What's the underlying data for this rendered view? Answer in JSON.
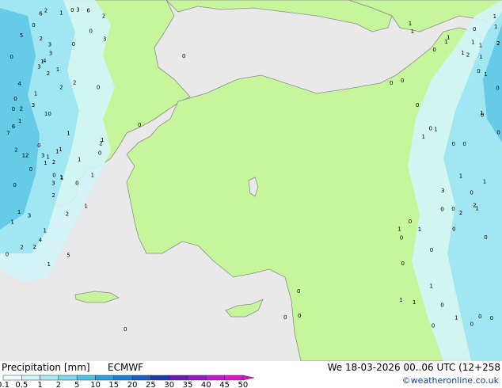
{
  "title": "Precipitation [mm]",
  "model": "ECMWF",
  "valid_time": "We 18-03-2026 00..06 UTC (12+258",
  "credit": "©weatheronline.co.uk",
  "colors": {
    "land": "#c6f59c",
    "sea": "#e9e9e9",
    "coast": "#8c8c8c",
    "rain_light": "#d2f5fa",
    "rain_mid": "#9ee6f2",
    "rain_heavy": "#5ec8e6"
  },
  "legend": {
    "ticks": [
      "0.1",
      "0.5",
      "1",
      "2",
      "5",
      "10",
      "15",
      "20",
      "25",
      "30",
      "35",
      "40",
      "45",
      "50"
    ],
    "colors": [
      "#ecfcff",
      "#cdf3fb",
      "#a8e9f6",
      "#7fd9f0",
      "#4fc2ea",
      "#2a9fe0",
      "#1a7fd6",
      "#1a5cc8",
      "#1a3cb0",
      "#6a1ab4",
      "#9a14c8",
      "#c814d6",
      "#e014c8"
    ]
  },
  "values_west": [
    "0",
    "2",
    "1",
    "2",
    "0",
    "6",
    "4",
    "3",
    "3",
    "2",
    "0",
    "5",
    "2",
    "2",
    "0",
    "6",
    "3",
    "0",
    "2",
    "0",
    "0",
    "1",
    "1",
    "0",
    "3",
    "1",
    "3",
    "4",
    "0",
    "1",
    "5",
    "2",
    "1",
    "1",
    "1",
    "3",
    "10",
    "4",
    "1",
    "2",
    "0",
    "2",
    "2",
    "6",
    "2",
    "0",
    "0",
    "1",
    "1",
    "1",
    "1",
    "2",
    "0",
    "1",
    "12",
    "3",
    "7",
    "3",
    "1",
    "1",
    "1",
    "1",
    "3",
    "2",
    "1",
    "2",
    "1",
    "0",
    "0"
  ],
  "values_east": [
    "1",
    "1",
    "0",
    "0",
    "0",
    "0",
    "1",
    "0",
    "2",
    "2",
    "0",
    "0",
    "1",
    "1",
    "1",
    "2",
    "0",
    "1",
    "0",
    "1",
    "1",
    "1",
    "0",
    "1",
    "1",
    "1",
    "3",
    "0",
    "1",
    "2",
    "1",
    "0",
    "1",
    "1",
    "1",
    "1",
    "0",
    "1",
    "0",
    "0",
    "0",
    "1",
    "1",
    "0",
    "0",
    "0",
    "0",
    "0",
    "0",
    "1",
    "0"
  ],
  "values_sea": [
    "0",
    "0",
    "0",
    "0",
    "0",
    "0",
    "0",
    "0",
    "0"
  ]
}
